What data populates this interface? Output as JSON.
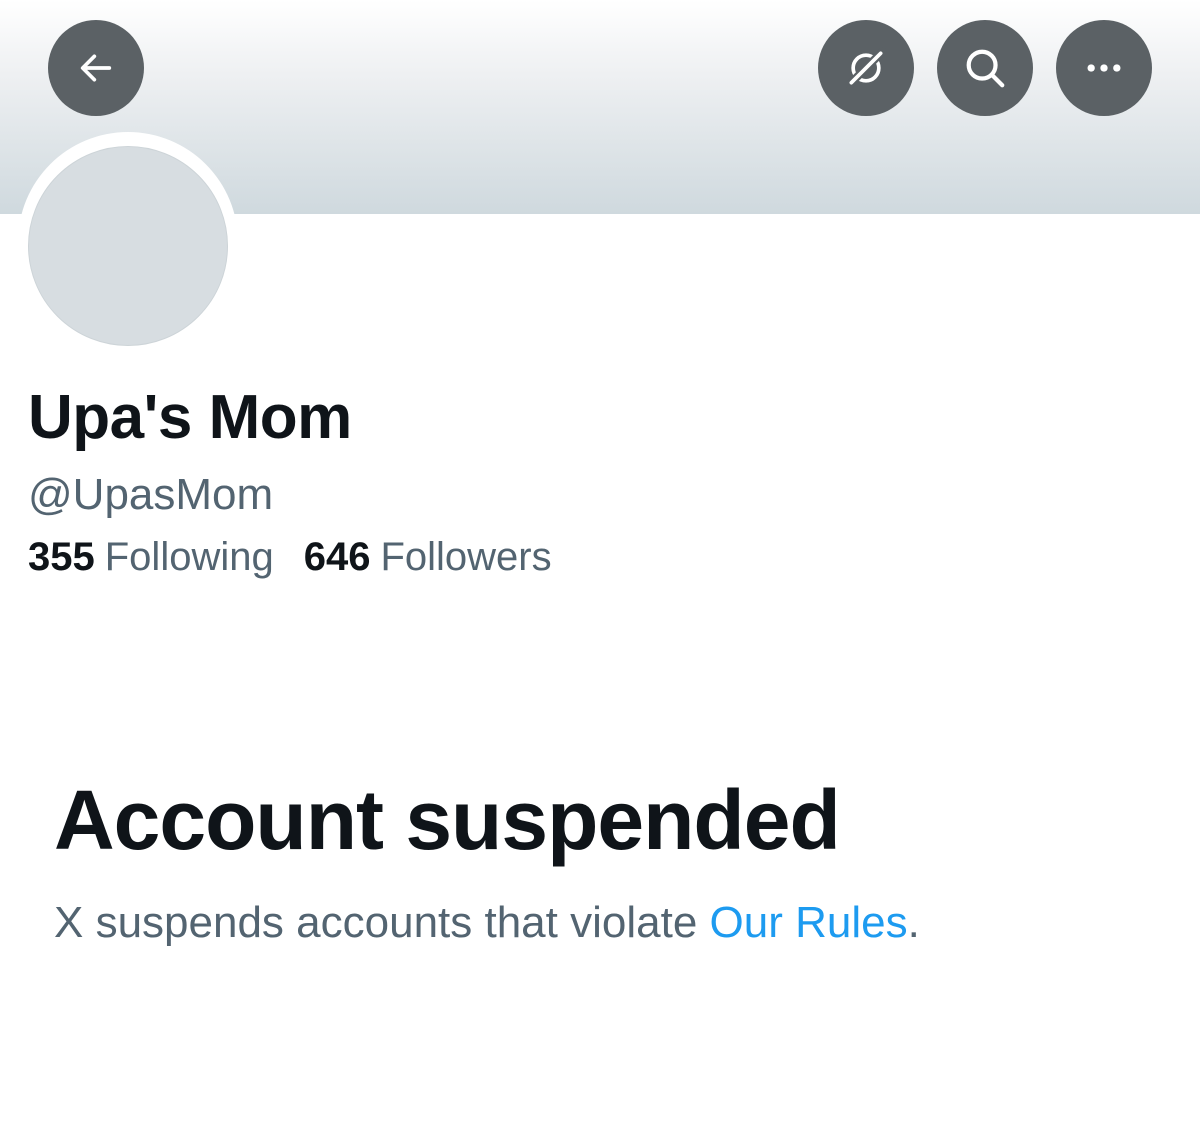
{
  "header": {
    "back_icon": "arrow-left-icon",
    "grok_icon": "grok-icon",
    "search_icon": "search-icon",
    "more_icon": "more-horizontal-icon",
    "button_color": "#5b6165"
  },
  "profile": {
    "display_name": "Upa's Mom",
    "handle": "@UpasMom",
    "following_count": "355",
    "following_label": "Following",
    "followers_count": "646",
    "followers_label": "Followers",
    "avatar_color": "#d7dde1"
  },
  "notice": {
    "title": "Account suspended",
    "text_prefix": "X suspends accounts that violate ",
    "link_label": "Our Rules",
    "text_suffix": ".",
    "link_color": "#1d9bf0"
  }
}
